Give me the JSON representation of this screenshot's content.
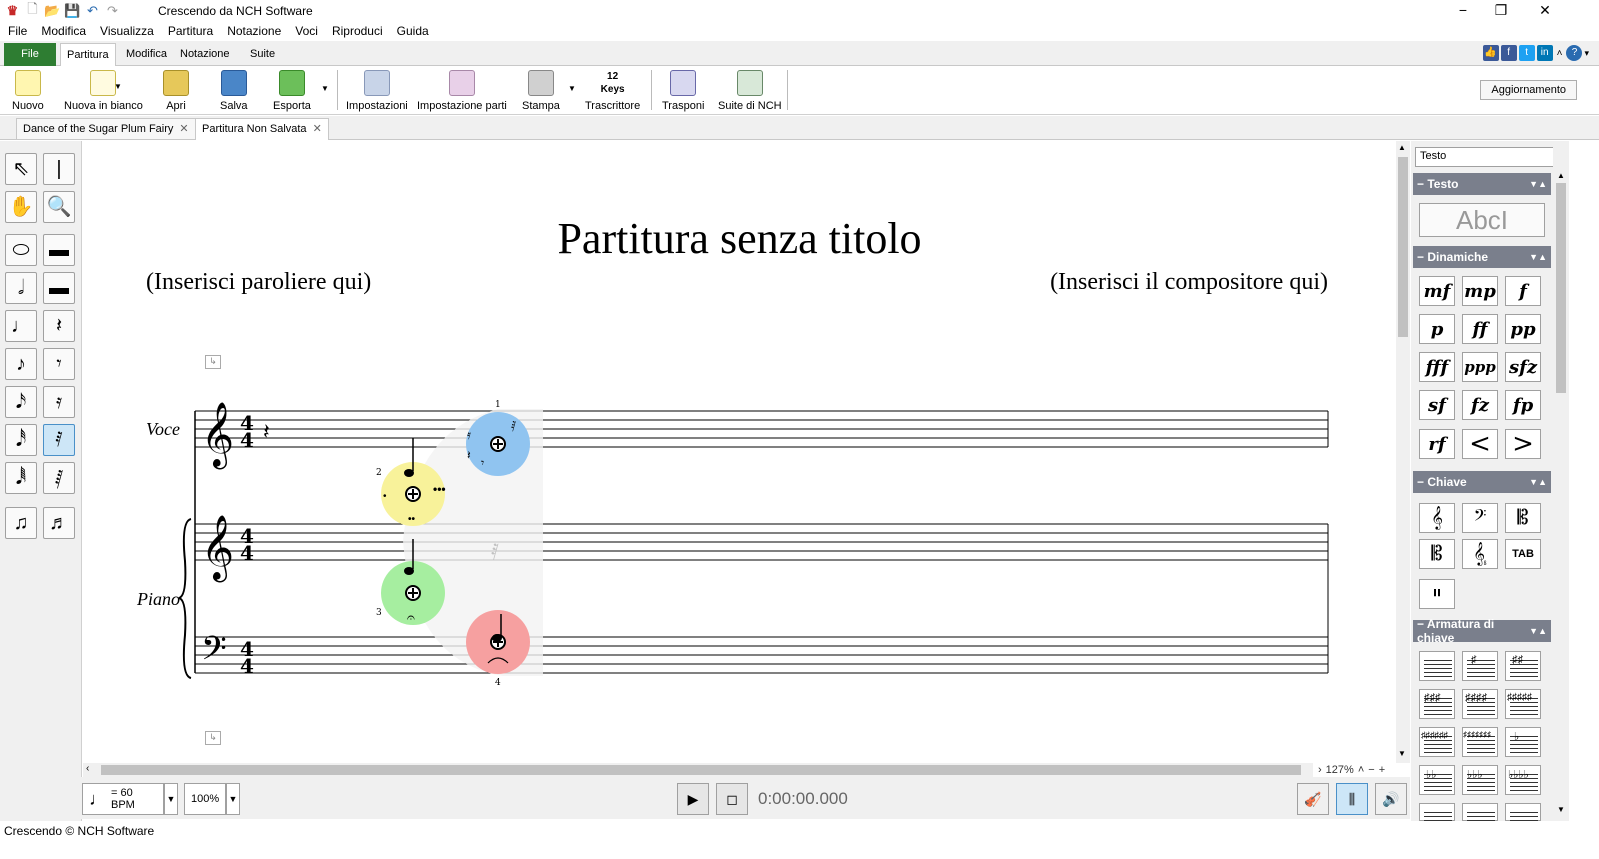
{
  "window": {
    "title": "Crescendo da NCH Software"
  },
  "menu": [
    "File",
    "Modifica",
    "Visualizza",
    "Partitura",
    "Notazione",
    "Voci",
    "Riproduci",
    "Guida"
  ],
  "ribbon_tabs": [
    "File",
    "Partitura",
    "Modifica",
    "Notazione",
    "Suite"
  ],
  "ribbon_active": "Partitura",
  "toolbar": {
    "nuovo": "Nuovo",
    "nuova_in_bianco": "Nuova in bianco",
    "apri": "Apri",
    "salva": "Salva",
    "esporta": "Esporta",
    "impostazioni": "Impostazioni",
    "impostazione_parti": "Impostazione parti",
    "stampa": "Stampa",
    "trascrittore": "Trascrittore",
    "trascrittore_icon_text": "12 Keys",
    "trasponi": "Trasponi",
    "suite": "Suite di NCH",
    "aggiornamento": "Aggiornamento"
  },
  "doc_tabs": [
    "Dance of the Sugar Plum Fairy",
    "Partitura Non Salvata"
  ],
  "score": {
    "title": "Partitura senza titolo",
    "lyricist": "(Inserisci paroliere qui)",
    "composer": "(Inserisci il compositore qui)",
    "staves": [
      "Voce",
      "Piano"
    ],
    "time_signature_top": "4",
    "time_signature_bottom": "4",
    "radial_labels": [
      "1",
      "2",
      "3",
      "4"
    ]
  },
  "bottom": {
    "tempo": "= 60 BPM",
    "zoom_volume": "100%",
    "time": "0:00:00.000",
    "zoom_level": "127%"
  },
  "status": "Crescendo © NCH Software",
  "right_panel": {
    "dropdown": "Testo",
    "sections": [
      "Testo",
      "Dinamiche",
      "Chiave",
      "Armatura di chiave"
    ],
    "text_button": "AbcI",
    "dynamics": [
      "mf",
      "mp",
      "f",
      "p",
      "ff",
      "pp",
      "fff",
      "ppp",
      "sfz",
      "sf",
      "fz",
      "fp",
      "rf",
      "<",
      ">"
    ]
  },
  "colors": {
    "file_tab": "#2e7d32",
    "section_header": "#7a7f8c",
    "radial_blue": "#90c4f0",
    "radial_yellow": "#f8f29a",
    "radial_green": "#a6eea0",
    "radial_red": "#f6a0a0"
  }
}
